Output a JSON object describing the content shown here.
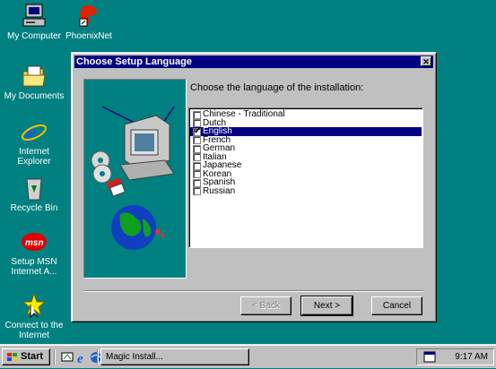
{
  "desktop": {
    "icons": [
      {
        "label": "My Computer",
        "icon": "my-computer-icon"
      },
      {
        "label": "PhoenixNet",
        "icon": "phoenixnet-icon"
      },
      {
        "label": "My Documents",
        "icon": "folder-icon"
      },
      {
        "label": "Internet\nExplorer",
        "icon": "internet-explorer-icon"
      },
      {
        "label": "Recycle Bin",
        "icon": "recycle-bin-icon"
      },
      {
        "label": "Setup MSN\nInternet A...",
        "icon": "msn-icon"
      },
      {
        "label": "Connect to the\nInternet",
        "icon": "connect-internet-icon"
      }
    ]
  },
  "dialog": {
    "title": "Choose Setup Language",
    "prompt": "Choose the language of the installation:",
    "languages": [
      {
        "label": "Chinese - Traditional",
        "checked": false,
        "selected": false
      },
      {
        "label": "Dutch",
        "checked": false,
        "selected": false
      },
      {
        "label": "English",
        "checked": true,
        "selected": true
      },
      {
        "label": "French",
        "checked": false,
        "selected": false
      },
      {
        "label": "German",
        "checked": false,
        "selected": false
      },
      {
        "label": "Italian",
        "checked": false,
        "selected": false
      },
      {
        "label": "Japanese",
        "checked": false,
        "selected": false
      },
      {
        "label": "Korean",
        "checked": false,
        "selected": false
      },
      {
        "label": "Spanish",
        "checked": false,
        "selected": false
      },
      {
        "label": "Russian",
        "checked": false,
        "selected": false
      }
    ],
    "buttons": {
      "back": "< Back",
      "next": "Next >",
      "cancel": "Cancel"
    },
    "close_glyph": "✕"
  },
  "taskbar": {
    "start_label": "Start",
    "task_label": "Magic Install...",
    "clock": "9:17 AM"
  },
  "colors": {
    "desktop": "#008080",
    "titlebar": "#000080",
    "selection": "#000080"
  }
}
